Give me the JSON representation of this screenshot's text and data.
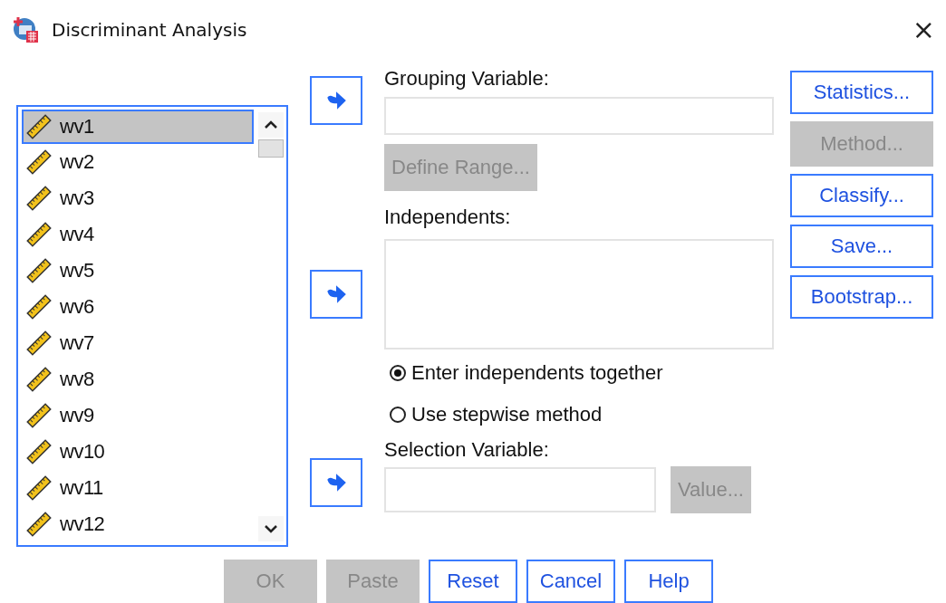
{
  "window": {
    "title": "Discriminant Analysis",
    "close": "×"
  },
  "variables": [
    {
      "name": "wv1",
      "selected": true
    },
    {
      "name": "wv2",
      "selected": false
    },
    {
      "name": "wv3",
      "selected": false
    },
    {
      "name": "wv4",
      "selected": false
    },
    {
      "name": "wv5",
      "selected": false
    },
    {
      "name": "wv6",
      "selected": false
    },
    {
      "name": "wv7",
      "selected": false
    },
    {
      "name": "wv8",
      "selected": false
    },
    {
      "name": "wv9",
      "selected": false
    },
    {
      "name": "wv10",
      "selected": false
    },
    {
      "name": "wv11",
      "selected": false
    },
    {
      "name": "wv12",
      "selected": false
    }
  ],
  "grouping": {
    "label": "Grouping Variable:",
    "define_range": {
      "label": "Define Range...",
      "disabled": true
    }
  },
  "independents": {
    "label": "Independents:"
  },
  "methods": [
    {
      "label": "Enter independents together",
      "selected": true
    },
    {
      "label": "Use stepwise method",
      "selected": false
    }
  ],
  "selection": {
    "label": "Selection Variable:",
    "value_button": {
      "label": "Value...",
      "disabled": true
    }
  },
  "side_buttons": [
    {
      "label": "Statistics...",
      "disabled": false
    },
    {
      "label": "Method...",
      "disabled": true
    },
    {
      "label": "Classify...",
      "disabled": false
    },
    {
      "label": "Save...",
      "disabled": false
    },
    {
      "label": "Bootstrap...",
      "disabled": false
    }
  ],
  "bottom_buttons": [
    {
      "label": "OK",
      "disabled": true
    },
    {
      "label": "Paste",
      "disabled": true
    },
    {
      "label": "Reset",
      "disabled": false
    },
    {
      "label": "Cancel",
      "disabled": false
    },
    {
      "label": "Help",
      "disabled": false
    }
  ]
}
